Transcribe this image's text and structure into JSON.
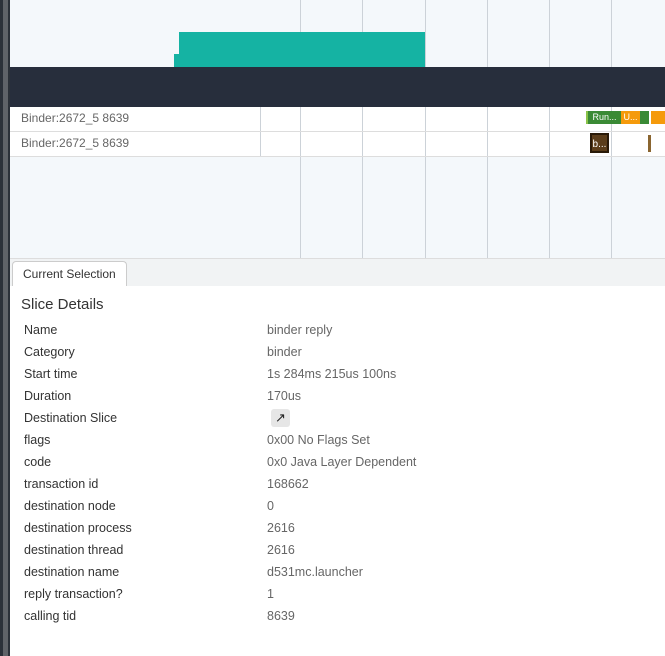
{
  "tracks": [
    {
      "label": "Binder:2672_5 8639"
    },
    {
      "label": "Binder:2672_5 8639"
    }
  ],
  "slices": {
    "running": "Run...",
    "unknown": "U...",
    "binder": "b..."
  },
  "colors": {
    "teal": "#15b3a3",
    "running": "#3a8a35",
    "orange": "#f59a0b",
    "binder": "#5b3d1a"
  },
  "tab": {
    "label": "Current Selection"
  },
  "details": {
    "title": "Slice Details",
    "rows": [
      {
        "k": "Name",
        "v": "binder reply"
      },
      {
        "k": "Category",
        "v": "binder"
      },
      {
        "k": "Start time",
        "v": "1s 284ms 215us 100ns"
      },
      {
        "k": "Duration",
        "v": "170us"
      },
      {
        "k": "Destination Slice",
        "v": ""
      },
      {
        "k": "flags",
        "v": "0x00 No Flags Set"
      },
      {
        "k": "code",
        "v": "0x0 Java Layer Dependent"
      },
      {
        "k": "transaction id",
        "v": "168662"
      },
      {
        "k": "destination node",
        "v": "0"
      },
      {
        "k": "destination process",
        "v": "2616"
      },
      {
        "k": "destination thread",
        "v": "2616"
      },
      {
        "k": "destination name",
        "v": "d531mc.launcher"
      },
      {
        "k": "reply transaction?",
        "v": "1"
      },
      {
        "k": "calling tid",
        "v": "8639"
      }
    ]
  },
  "icons": {
    "goto": "↗"
  }
}
